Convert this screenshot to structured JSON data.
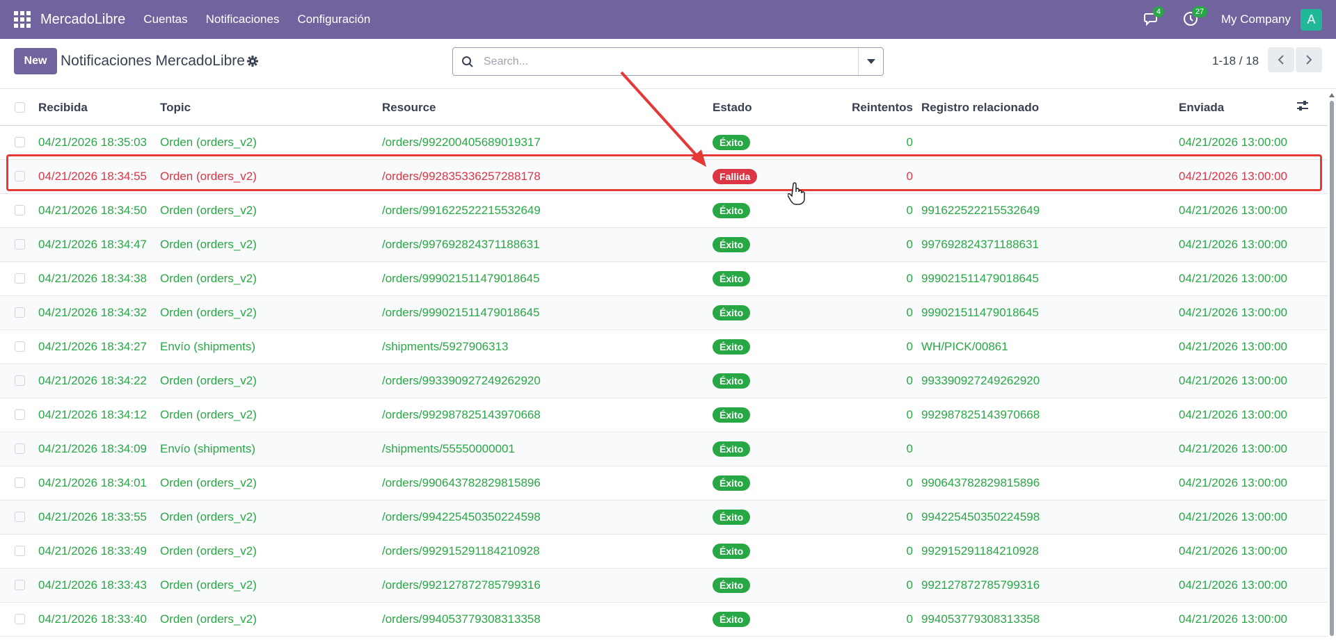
{
  "nav": {
    "brand": "MercadoLibre",
    "menus": [
      "Cuentas",
      "Notificaciones",
      "Configuración"
    ],
    "messages_badge": "4",
    "activity_badge": "27",
    "company": "My Company",
    "avatar_letter": "A"
  },
  "control": {
    "new_label": "New",
    "title": "Notificaciones MercadoLibre",
    "search_placeholder": "Search...",
    "pager": "1-18 / 18"
  },
  "table": {
    "columns": [
      "Recibida",
      "Topic",
      "Resource",
      "Estado",
      "Reintentos",
      "Registro relacionado",
      "Enviada"
    ],
    "rows": [
      {
        "recibida": "04/21/2026 18:35:03",
        "topic": "Orden (orders_v2)",
        "resource": "/orders/992200405689019317",
        "estado": "Éxito",
        "reintentos": "0",
        "registro": "",
        "enviada": "04/21/2026 13:00:00",
        "failed": false
      },
      {
        "recibida": "04/21/2026 18:34:55",
        "topic": "Orden (orders_v2)",
        "resource": "/orders/992835336257288178",
        "estado": "Fallida",
        "reintentos": "0",
        "registro": "",
        "enviada": "04/21/2026 13:00:00",
        "failed": true
      },
      {
        "recibida": "04/21/2026 18:34:50",
        "topic": "Orden (orders_v2)",
        "resource": "/orders/991622522215532649",
        "estado": "Éxito",
        "reintentos": "0",
        "registro": "991622522215532649",
        "enviada": "04/21/2026 13:00:00",
        "failed": false
      },
      {
        "recibida": "04/21/2026 18:34:47",
        "topic": "Orden (orders_v2)",
        "resource": "/orders/997692824371188631",
        "estado": "Éxito",
        "reintentos": "0",
        "registro": "997692824371188631",
        "enviada": "04/21/2026 13:00:00",
        "failed": false
      },
      {
        "recibida": "04/21/2026 18:34:38",
        "topic": "Orden (orders_v2)",
        "resource": "/orders/999021511479018645",
        "estado": "Éxito",
        "reintentos": "0",
        "registro": "999021511479018645",
        "enviada": "04/21/2026 13:00:00",
        "failed": false
      },
      {
        "recibida": "04/21/2026 18:34:32",
        "topic": "Orden (orders_v2)",
        "resource": "/orders/999021511479018645",
        "estado": "Éxito",
        "reintentos": "0",
        "registro": "999021511479018645",
        "enviada": "04/21/2026 13:00:00",
        "failed": false
      },
      {
        "recibida": "04/21/2026 18:34:27",
        "topic": "Envío (shipments)",
        "resource": "/shipments/5927906313",
        "estado": "Éxito",
        "reintentos": "0",
        "registro": "WH/PICK/00861",
        "enviada": "04/21/2026 13:00:00",
        "failed": false
      },
      {
        "recibida": "04/21/2026 18:34:22",
        "topic": "Orden (orders_v2)",
        "resource": "/orders/993390927249262920",
        "estado": "Éxito",
        "reintentos": "0",
        "registro": "993390927249262920",
        "enviada": "04/21/2026 13:00:00",
        "failed": false
      },
      {
        "recibida": "04/21/2026 18:34:12",
        "topic": "Orden (orders_v2)",
        "resource": "/orders/992987825143970668",
        "estado": "Éxito",
        "reintentos": "0",
        "registro": "992987825143970668",
        "enviada": "04/21/2026 13:00:00",
        "failed": false
      },
      {
        "recibida": "04/21/2026 18:34:09",
        "topic": "Envío (shipments)",
        "resource": "/shipments/55550000001",
        "estado": "Éxito",
        "reintentos": "0",
        "registro": "",
        "enviada": "04/21/2026 13:00:00",
        "failed": false
      },
      {
        "recibida": "04/21/2026 18:34:01",
        "topic": "Orden (orders_v2)",
        "resource": "/orders/990643782829815896",
        "estado": "Éxito",
        "reintentos": "0",
        "registro": "990643782829815896",
        "enviada": "04/21/2026 13:00:00",
        "failed": false
      },
      {
        "recibida": "04/21/2026 18:33:55",
        "topic": "Orden (orders_v2)",
        "resource": "/orders/994225450350224598",
        "estado": "Éxito",
        "reintentos": "0",
        "registro": "994225450350224598",
        "enviada": "04/21/2026 13:00:00",
        "failed": false
      },
      {
        "recibida": "04/21/2026 18:33:49",
        "topic": "Orden (orders_v2)",
        "resource": "/orders/992915291184210928",
        "estado": "Éxito",
        "reintentos": "0",
        "registro": "992915291184210928",
        "enviada": "04/21/2026 13:00:00",
        "failed": false
      },
      {
        "recibida": "04/21/2026 18:33:43",
        "topic": "Orden (orders_v2)",
        "resource": "/orders/992127872785799316",
        "estado": "Éxito",
        "reintentos": "0",
        "registro": "992127872785799316",
        "enviada": "04/21/2026 13:00:00",
        "failed": false
      },
      {
        "recibida": "04/21/2026 18:33:40",
        "topic": "Orden (orders_v2)",
        "resource": "/orders/994053779308313358",
        "estado": "Éxito",
        "reintentos": "0",
        "registro": "994053779308313358",
        "enviada": "04/21/2026 13:00:00",
        "failed": false
      }
    ]
  },
  "colors": {
    "brand": "#71639e",
    "success": "#28a745",
    "danger": "#dc3545",
    "annotation": "#e53935"
  },
  "icons": [
    "apps-grid-icon",
    "chat-icon",
    "clock-icon",
    "gear-icon",
    "search-icon",
    "chevron-left-icon",
    "chevron-right-icon",
    "column-settings-icon",
    "hand-cursor-icon"
  ]
}
